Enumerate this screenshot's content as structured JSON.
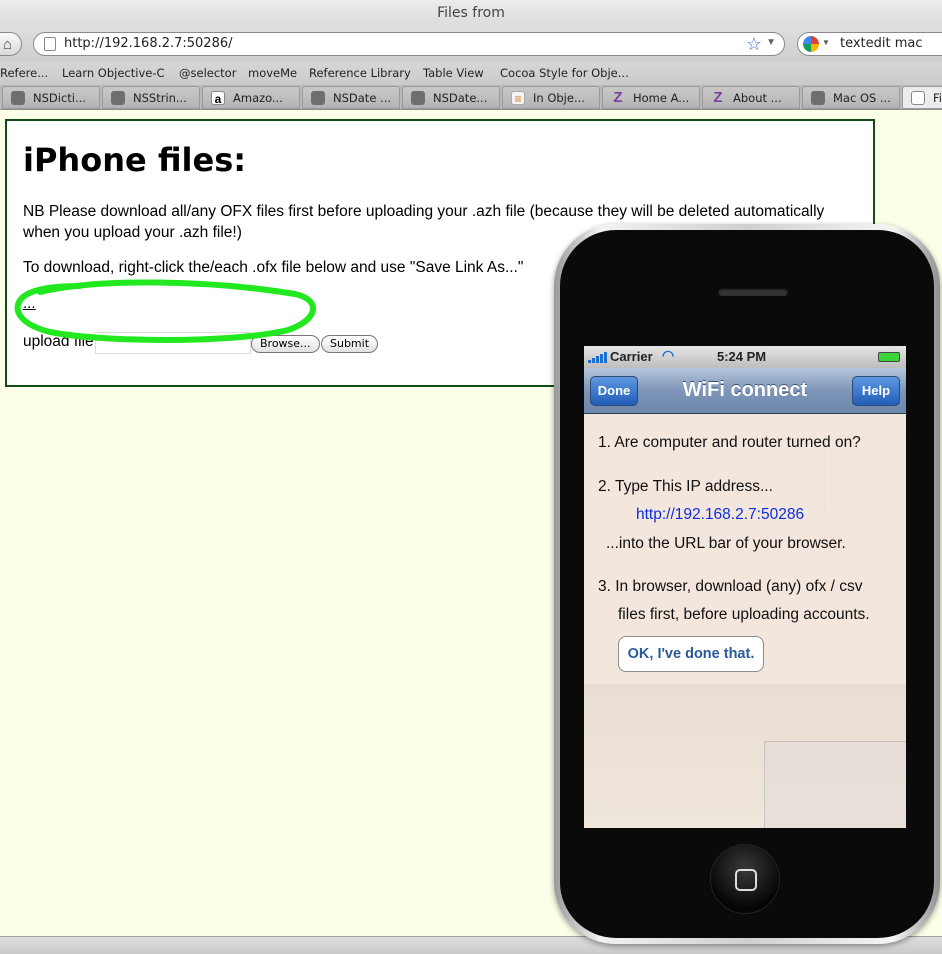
{
  "window": {
    "title": "Files from"
  },
  "nav": {
    "url": "http://192.168.2.7:50286/",
    "search_value": "textedit mac"
  },
  "bookmarks": [
    "Refere...",
    "Learn Objective-C",
    "@selector",
    "moveMe",
    "Reference Library",
    "Table View",
    "Cocoa Style for Obje..."
  ],
  "tabs": [
    {
      "label": "NSDicti...",
      "icon": "apple-icon"
    },
    {
      "label": "NSStrin...",
      "icon": "apple-icon"
    },
    {
      "label": "Amazo...",
      "icon": "amazon-icon"
    },
    {
      "label": "NSDate ...",
      "icon": "apple-icon"
    },
    {
      "label": "NSDate...",
      "icon": "apple-icon"
    },
    {
      "label": "In Obje...",
      "icon": "stackoverflow-icon"
    },
    {
      "label": "Home A...",
      "icon": "zotero-icon"
    },
    {
      "label": "About ...",
      "icon": "zotero-icon"
    },
    {
      "label": "Mac OS ...",
      "icon": "apple-icon"
    },
    {
      "label": "Fi",
      "icon": "page-icon"
    }
  ],
  "page": {
    "heading": "iPhone files:",
    "note": "NB Please download all/any OFX files first before uploading your .azh file (because they will be deleted automatically when you upload your .azh file!)",
    "instruction": "To download, right-click the/each .ofx file below and use \"Save Link As...\"",
    "ellipsis_link": "...",
    "upload_label": "upload file",
    "browse_label": "Browse...",
    "submit_label": "Submit"
  },
  "iphone": {
    "carrier": "Carrier",
    "time": "5:24 PM",
    "title": "WiFi connect",
    "done_label": "Done",
    "help_label": "Help",
    "step1": "1. Are computer and router turned on?",
    "step2": "2. Type This IP address...",
    "ip": "http://192.168.2.7:50286",
    "into": "...into the URL bar of your browser.",
    "step3a": "3. In browser, download (any) ofx / csv",
    "step3b": "files first, before uploading accounts.",
    "ok_label": "OK, I've done that."
  },
  "colors": {
    "page_bg": "#fdfee8",
    "highlight": "#22e81f",
    "content_border": "#144a14",
    "ios_link": "#0c2ee0"
  }
}
